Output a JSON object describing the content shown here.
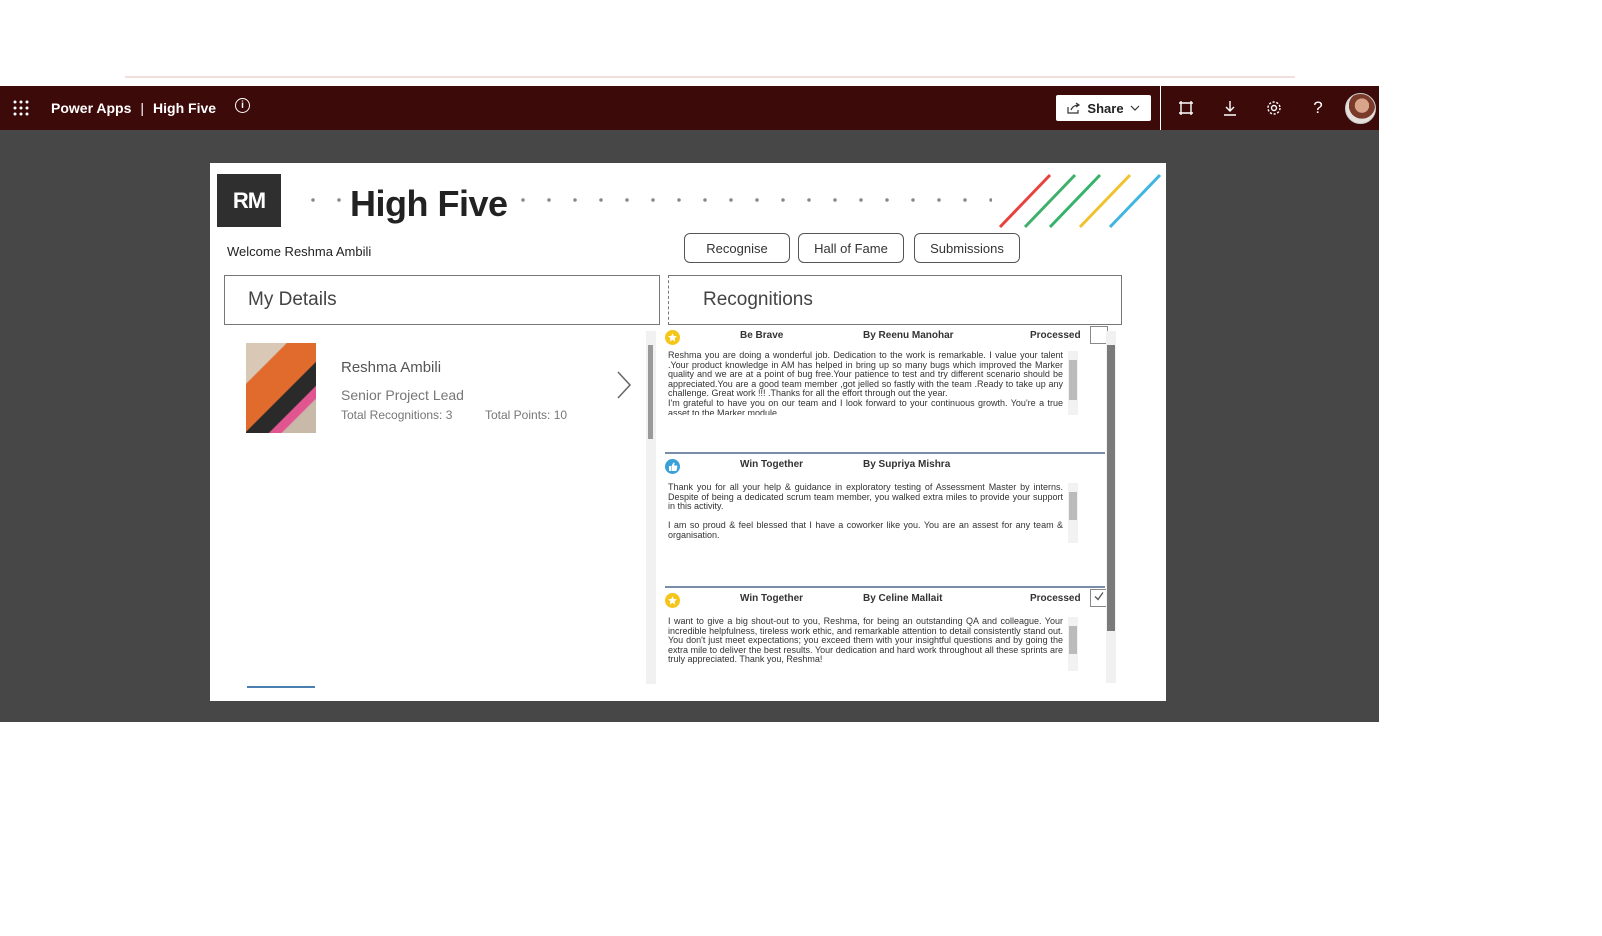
{
  "header": {
    "product": "Power Apps",
    "app_name": "High Five",
    "share_label": "Share"
  },
  "app": {
    "logo_text": "RM",
    "title": "High Five",
    "welcome": "Welcome Reshma Ambili",
    "nav": [
      "Recognise",
      "Hall of Fame",
      "Submissions"
    ]
  },
  "my_details": {
    "heading": "My Details",
    "name": "Reshma Ambili",
    "role": "Senior Project Lead",
    "total_recognitions": "Total Recognitions: 3",
    "total_points": "Total Points: 10"
  },
  "recognitions": {
    "heading": "Recognitions",
    "items": [
      {
        "icon": "star-badge-icon",
        "icon_color": "#f5c518",
        "category": "Be Brave",
        "by": "By Reenu Manohar",
        "status": "Processed",
        "checked": false,
        "message": "Reshma you are doing a wonderful job. Dedication to the work is remarkable. I value your talent .Your product knowledge in AM has helped in bring up so many bugs which improved the Marker quality and we are at a point of bug free.Your patience to test and try different scenario should be appreciated.You are a good team member ,got jelled so fastly with the team .Ready to take up any challenge. Great work !!! .Thanks for all the effort through out the year.\nI'm grateful to have you on our team and I look forward to your continuous growth. You're a true asset to the Marker module."
      },
      {
        "icon": "thumbs-up-icon",
        "icon_color": "#3aa0d8",
        "category": "Win Together",
        "by": "By Supriya Mishra",
        "status": "",
        "checked": false,
        "message": "Thank you for all your help & guidance in exploratory testing of Assessment Master by interns. Despite of being a dedicated scrum team member, you walked extra miles to provide your support in this activity.\n\nI am so proud & feel blessed that I have a coworker like you. You are an assest for any team & organisation."
      },
      {
        "icon": "star-badge-icon",
        "icon_color": "#f5c518",
        "category": "Win Together",
        "by": "By Celine Mallait",
        "status": "Processed",
        "checked": true,
        "message": "I want to give a big shout-out to you, Reshma, for being an outstanding QA and colleague. Your incredible helpfulness, tireless work ethic, and remarkable attention to detail consistently stand out. You don't just meet expectations; you exceed them with your insightful questions and by going the extra mile to deliver the best results. Your dedication and hard work throughout all these sprints are truly appreciated. Thank you, Reshma!"
      }
    ]
  },
  "colors": {
    "topbar": "#3d0a0a",
    "stage": "#474747",
    "stripes": [
      "#e8423f",
      "#3fb06b",
      "#35b36a",
      "#f2c12e",
      "#3fb5e0"
    ]
  }
}
